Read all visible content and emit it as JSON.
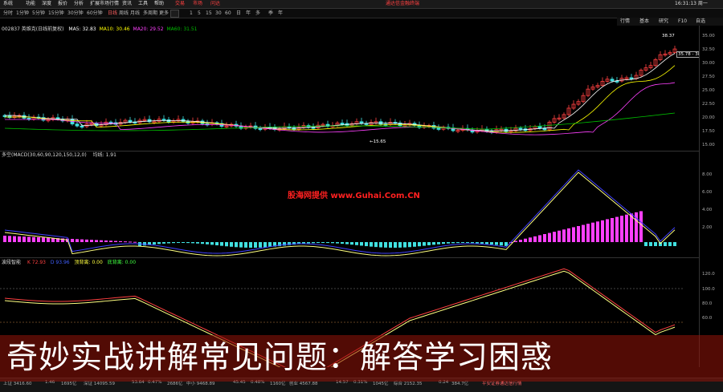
{
  "menubar": {
    "items": [
      "系统",
      "功能",
      "深度",
      "报价",
      "分析",
      "扩展市场行情",
      "资讯",
      "工具",
      "帮助"
    ],
    "quick_buttons": [
      "交易",
      "市场",
      "问达"
    ],
    "ad_text": "通达信金融终端",
    "time": "16:31:13 周一"
  },
  "toolbar": {
    "periods": [
      "分时",
      "1分钟",
      "5分钟",
      "15分钟",
      "30分钟",
      "60分钟",
      "日线",
      "周线",
      "月线",
      "多周期",
      "更多"
    ],
    "days": [
      "1",
      "5",
      "15",
      "30",
      "60",
      "日",
      "年",
      "多",
      "季",
      "年"
    ]
  },
  "right_nav": [
    "行情",
    "基本",
    "研究",
    "F10",
    "自选"
  ],
  "main_panel": {
    "title": "002837 英维克(日线前复权)",
    "ma5_label": "MA5: 32.83",
    "ma10_label": "MA10: 30.46",
    "ma20_label": "MA20: 29.52",
    "ma60_label": "MA60: 31.51",
    "high_label": "38.37",
    "price_box": "35.78 - 38.9",
    "low_label": "←15.65",
    "axis": [
      "35.00",
      "32.50",
      "30.00",
      "27.50",
      "25.00",
      "22.50",
      "20.00",
      "17.50",
      "15.00"
    ]
  },
  "macd_panel": {
    "title": "多空(MACD(30,60,90,120,150,12,0)",
    "value": "均线: 1.91",
    "axis": [
      "8.00",
      "6.00",
      "4.00",
      "2.00"
    ]
  },
  "kdj_panel": {
    "title": "波段智能",
    "k_label": "K 72.93",
    "d_label": "D 93.96",
    "top_label": "顶背离: 0.00",
    "bottom_label": "底背离: 0.00",
    "axis": [
      "120.0",
      "100.0",
      "80.0",
      "60.0"
    ]
  },
  "watermark": "股海网提供 www.Guhai.Com.CN",
  "banner_text": "奇妙实战讲解常见问题：解答学习困惑",
  "bottom_bar": {
    "items": [
      "上证 3416.60",
      "1.46",
      "1695亿",
      "深证 14095.59",
      "53.64",
      "0.47%",
      "2686亿",
      "中小 9468.89",
      "45.45",
      "0.48%",
      "1160亿",
      "创业 4567.88",
      "14.57",
      "0.31%",
      "1045亿",
      "综合 2152.35",
      "0.24",
      "384.7亿",
      "平安证券通达信行情"
    ]
  },
  "colors": {
    "up": "#ff4040",
    "down": "#40e0e0",
    "ma5": "#ffffff",
    "ma10": "#ffff00",
    "ma20": "#ff40ff",
    "ma60": "#00c000",
    "macd_pos": "#ff40ff",
    "macd_neg": "#40e0e0"
  }
}
